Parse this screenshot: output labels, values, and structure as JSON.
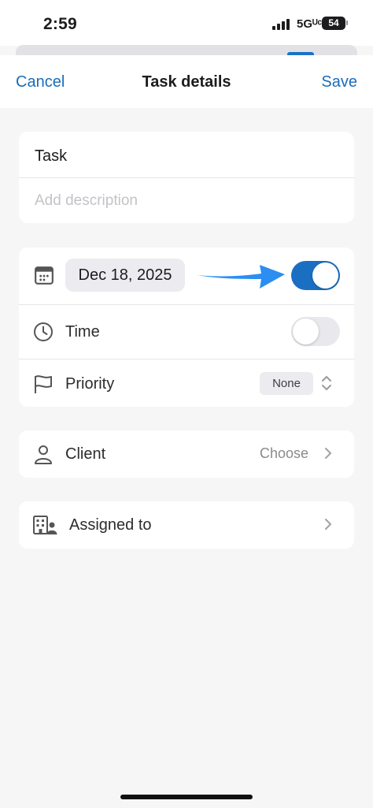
{
  "status_bar": {
    "time": "2:59",
    "network": "5Gᵁᶜ",
    "battery": "54"
  },
  "nav": {
    "cancel_label": "Cancel",
    "title": "Task details",
    "save_label": "Save"
  },
  "task": {
    "title": "Task",
    "description_placeholder": "Add description"
  },
  "schedule": {
    "date": "Dec 18, 2025",
    "date_toggle_on": true,
    "time_label": "Time",
    "time_toggle_on": false,
    "priority_label": "Priority",
    "priority_value": "None"
  },
  "client": {
    "label": "Client",
    "value": "Choose"
  },
  "assigned": {
    "label": "Assigned to"
  },
  "colors": {
    "accent": "#1a6dba",
    "toggle_on": "#1b6fc2",
    "annotation_arrow": "#2b8ef0"
  },
  "icons": [
    "signal-icon",
    "calendar-icon",
    "clock-icon",
    "flag-icon",
    "chevron-updown-icon",
    "person-icon",
    "building-person-icon",
    "chevron-right-icon",
    "annotation-arrow-icon"
  ]
}
